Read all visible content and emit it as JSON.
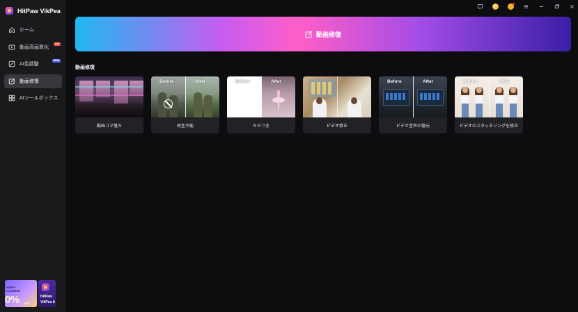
{
  "app": {
    "name": "HitPaw VikPea"
  },
  "sidebar": {
    "items": [
      {
        "label": "ホーム",
        "icon": "home-icon",
        "active": false,
        "badge": ""
      },
      {
        "label": "動画高画質化",
        "icon": "video-play-icon",
        "active": false,
        "badge": "Hot"
      },
      {
        "label": "AI色調整",
        "icon": "color-adjust-icon",
        "active": false,
        "badge": "NEW"
      },
      {
        "label": "動画修復",
        "icon": "edit-icon",
        "active": true,
        "badge": ""
      },
      {
        "label": "AIツールボックス",
        "icon": "toolbox-icon",
        "active": false,
        "badge": ""
      }
    ],
    "promo": {
      "line1": "HAPPY",
      "line2": "LLOWEEN",
      "big": "0%",
      "off": "OFF"
    },
    "app_card": {
      "line1": "HitPaw",
      "line2": "VikPea A"
    }
  },
  "titlebar": {
    "icons": [
      "feedback-icon",
      "avatar-icon",
      "user-icon",
      "menu-icon",
      "minimize-icon",
      "maximize-icon",
      "close-icon"
    ]
  },
  "banner": {
    "label": "動画修復",
    "icon": "edit-icon"
  },
  "section": {
    "title": "動画修復"
  },
  "cards": [
    {
      "label": "動画コマ落ち",
      "before": "",
      "after": ""
    },
    {
      "label": "再生不能",
      "before": "Before",
      "after": "After"
    },
    {
      "label": "ちらつき",
      "before": "Before",
      "after": "After"
    },
    {
      "label": "ピデオ修正",
      "before": "",
      "after": ""
    },
    {
      "label": "ピデオ音声の復元",
      "before": "Before",
      "after": "After"
    },
    {
      "label": "ビデオのスタッタリングを修正",
      "before": "Before",
      "after": "After"
    }
  ],
  "colors": {
    "accent_active": "#37373c",
    "sidebar_bg": "#1a1a1d",
    "content_bg": "#0d0d10",
    "card_bg": "#222226"
  }
}
